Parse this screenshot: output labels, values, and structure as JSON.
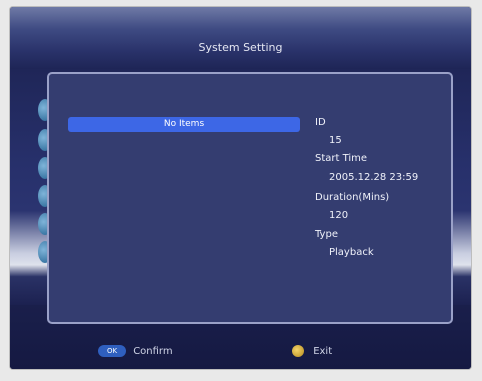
{
  "header": {
    "title": "System Setting"
  },
  "list": {
    "items": [
      {
        "label": "No Items"
      }
    ]
  },
  "info": {
    "id_label": "ID",
    "id_value": "15",
    "start_time_label": "Start Time",
    "start_time_value": "2005.12.28 23:59",
    "duration_label": "Duration(Mins)",
    "duration_value": "120",
    "type_label": "Type",
    "type_value": "Playback"
  },
  "footer": {
    "confirm_key": "OK",
    "confirm_label": "Confirm",
    "exit_label": "Exit"
  },
  "colors": {
    "dialog_bg": "#343d70",
    "highlight": "#3d67e6",
    "screen_bg": "#1b1f4d"
  }
}
